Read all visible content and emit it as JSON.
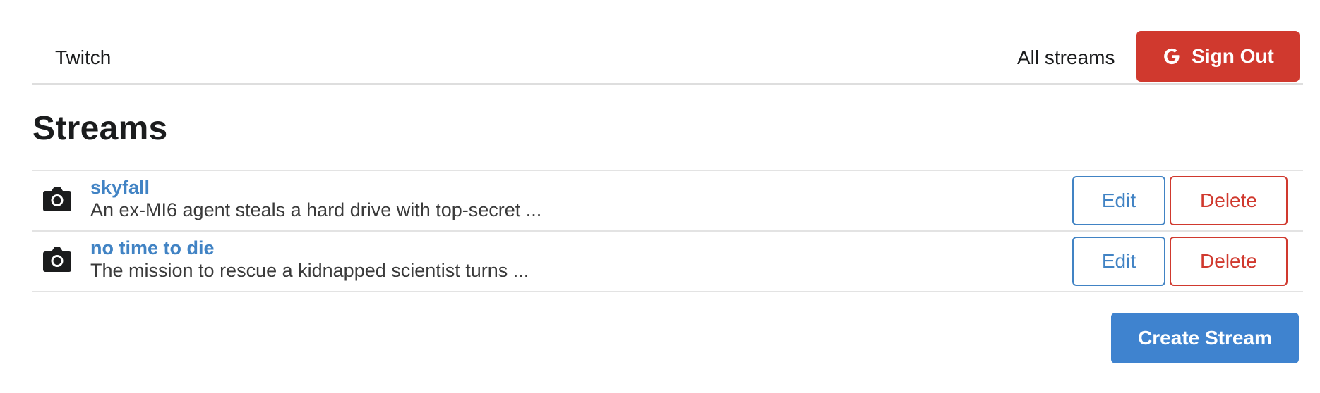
{
  "header": {
    "brand": "Twitch",
    "all_streams": "All streams",
    "signout_label": "Sign Out",
    "signout_icon": "google-icon"
  },
  "page": {
    "title": "Streams"
  },
  "streams": [
    {
      "icon": "camera-icon",
      "title": "skyfall",
      "description": "An ex-MI6 agent steals a hard drive with top-secret ...",
      "edit_label": "Edit",
      "delete_label": "Delete"
    },
    {
      "icon": "camera-icon",
      "title": "no time to die",
      "description": "The mission to rescue a kidnapped scientist turns ...",
      "edit_label": "Edit",
      "delete_label": "Delete"
    }
  ],
  "actions": {
    "create_label": "Create Stream"
  },
  "colors": {
    "primary": "#3f83cf",
    "link": "#4183c4",
    "danger": "#d0392e",
    "divider": "#e3e3e3"
  }
}
